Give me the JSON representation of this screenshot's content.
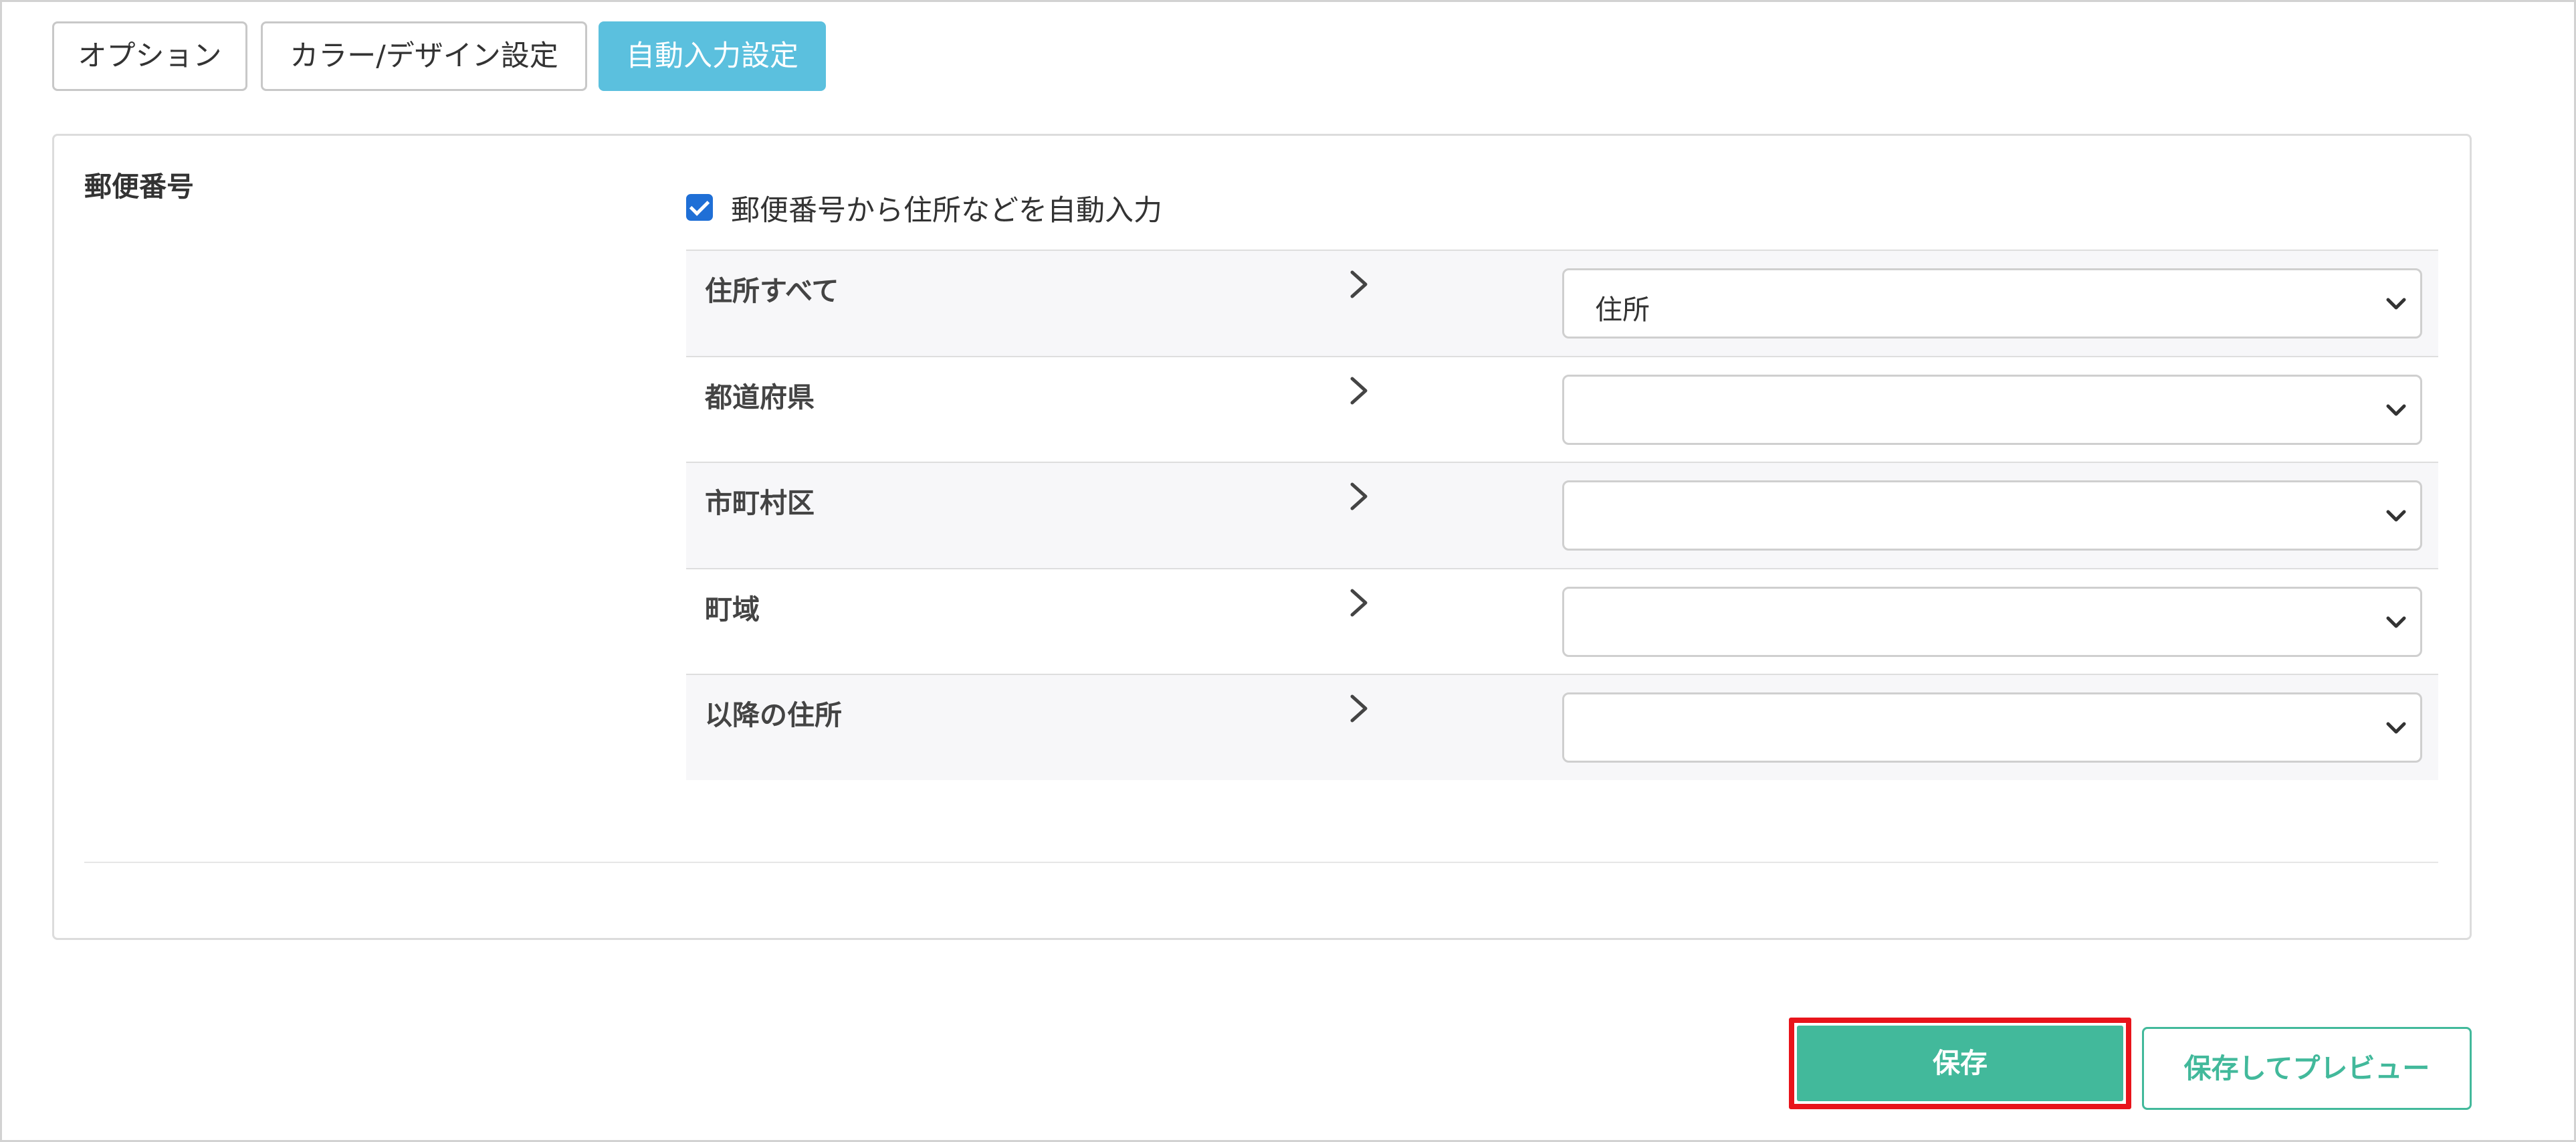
{
  "tabs": [
    {
      "label": "オプション",
      "active": false
    },
    {
      "label": "カラー/デザイン設定",
      "active": false
    },
    {
      "label": "自動入力設定",
      "active": true
    }
  ],
  "section": {
    "label": "郵便番号",
    "checkbox": {
      "label": "郵便番号から住所などを自動入力",
      "checked": true
    },
    "rows": [
      {
        "label": "住所すべて",
        "selected": "住所"
      },
      {
        "label": "都道府県",
        "selected": ""
      },
      {
        "label": "市町村区",
        "selected": ""
      },
      {
        "label": "町域",
        "selected": ""
      },
      {
        "label": "以降の住所",
        "selected": ""
      }
    ]
  },
  "footer": {
    "save_label": "保存",
    "preview_label": "保存してプレビュー"
  },
  "colors": {
    "accent": "#42b99b",
    "active_tab": "#5bc0de",
    "highlight": "#e8141b",
    "checkbox": "#1f6fd6"
  },
  "icons": {
    "row_indicator": "chevron-right-icon",
    "select_caret": "chevron-down-icon"
  }
}
